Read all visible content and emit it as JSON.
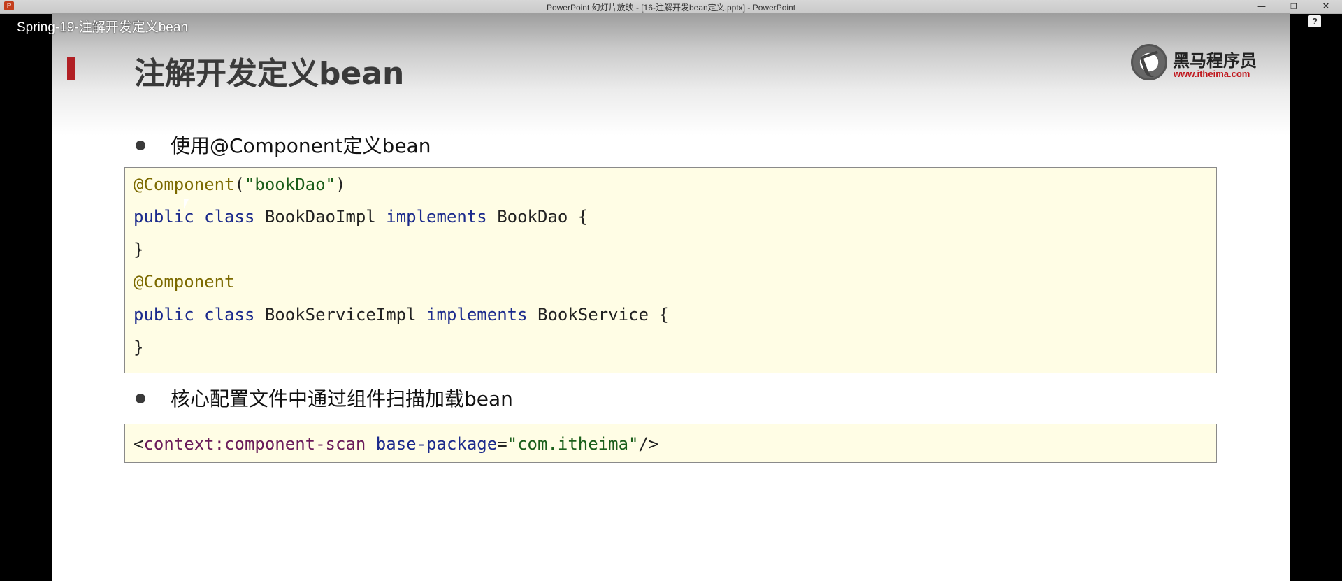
{
  "window": {
    "title": "PowerPoint 幻灯片放映 - [16-注解开发bean定义.pptx] - PowerPoint",
    "app_icon": "P",
    "minimize": "—",
    "restore": "❐",
    "close": "✕"
  },
  "video": {
    "title": "Spring-19-注解开发定义bean",
    "help": "?"
  },
  "slide": {
    "title": "注解开发定义bean",
    "logo": {
      "name": "黑马程序员",
      "url": "www.itheima.com"
    },
    "bullets": [
      "使用@Component定义bean",
      "核心配置文件中通过组件扫描加载bean"
    ],
    "code1": {
      "l1_ann": "@Component",
      "l1_open": "(",
      "l1_str": "\"bookDao\"",
      "l1_close": ")",
      "l2_kw": "public class",
      "l2_name": "BookDaoImpl",
      "l2_kw2": "implements",
      "l2_iface": "BookDao {",
      "l3": "}",
      "l4_ann": "@Component",
      "l5_kw": "public class",
      "l5_name": "BookServiceImpl",
      "l5_kw2": "implements",
      "l5_iface": "BookService {",
      "l6": "}"
    },
    "code2": {
      "lt": "<",
      "tag": "context:component-scan",
      "attr": "base-package",
      "eq": "=",
      "val": "\"com.itheima\"",
      "end": "/>"
    }
  },
  "colors": {
    "accent": "#b11f24",
    "code_bg": "#fffde5",
    "keyword": "#1b2a8c",
    "annotation": "#7c6a00",
    "string": "#1a5e1a"
  }
}
